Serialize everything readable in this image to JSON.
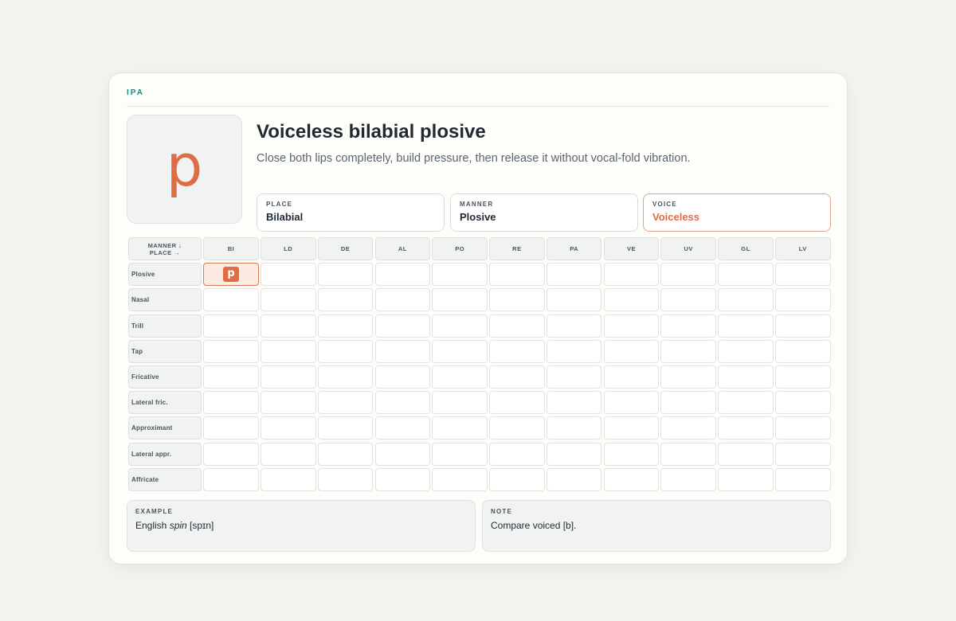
{
  "brand": "IPA",
  "phone": {
    "symbol": "p",
    "title": "Voiceless bilabial plosive",
    "description": "Close both lips completely, build pressure, then release it without vocal-fold vibration."
  },
  "features": [
    {
      "label": "PLACE",
      "value": "Bilabial"
    },
    {
      "label": "MANNER",
      "value": "Plosive"
    },
    {
      "label": "VOICE",
      "value": "Voiceless"
    }
  ],
  "grid": {
    "corner_top": "MANNER ↓",
    "corner_bottom": "PLACE →",
    "columns": [
      "BI",
      "LD",
      "DE",
      "AL",
      "PO",
      "RE",
      "PA",
      "VE",
      "UV",
      "GL",
      "LV"
    ],
    "rows": [
      "Plosive",
      "Nasal",
      "Trill",
      "Tap",
      "Fricative",
      "Lateral fric.",
      "Approximant",
      "Lateral appr.",
      "Affricate"
    ],
    "selected": {
      "row": "Plosive",
      "column": "BI",
      "symbol": "p"
    }
  },
  "example": {
    "label": "EXAMPLE",
    "prefix": "English ",
    "word": "spin",
    "transcription": " [spɪn]"
  },
  "note": {
    "label": "NOTE",
    "text": "Compare voiced [b]."
  },
  "colors": {
    "accent": "#e06c45",
    "brand": "#1f8a83",
    "selected_bg": "#fcebe3"
  }
}
